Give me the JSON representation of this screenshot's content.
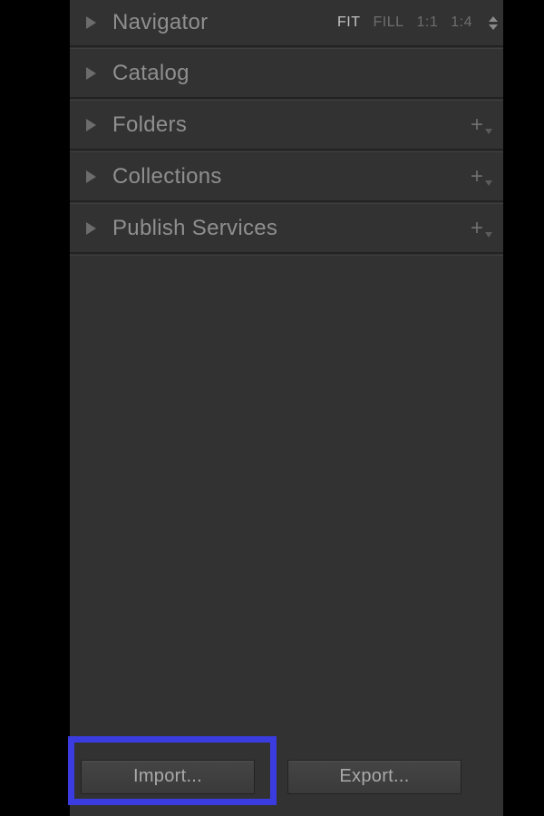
{
  "panels": {
    "navigator": {
      "title": "Navigator",
      "zoom": {
        "fit": "FIT",
        "fill": "FILL",
        "one_to_one": "1:1",
        "one_to_four": "1:4"
      }
    },
    "catalog": {
      "title": "Catalog"
    },
    "folders": {
      "title": "Folders"
    },
    "collections": {
      "title": "Collections"
    },
    "publish": {
      "title": "Publish Services"
    }
  },
  "footer": {
    "import_label": "Import...",
    "export_label": "Export..."
  }
}
